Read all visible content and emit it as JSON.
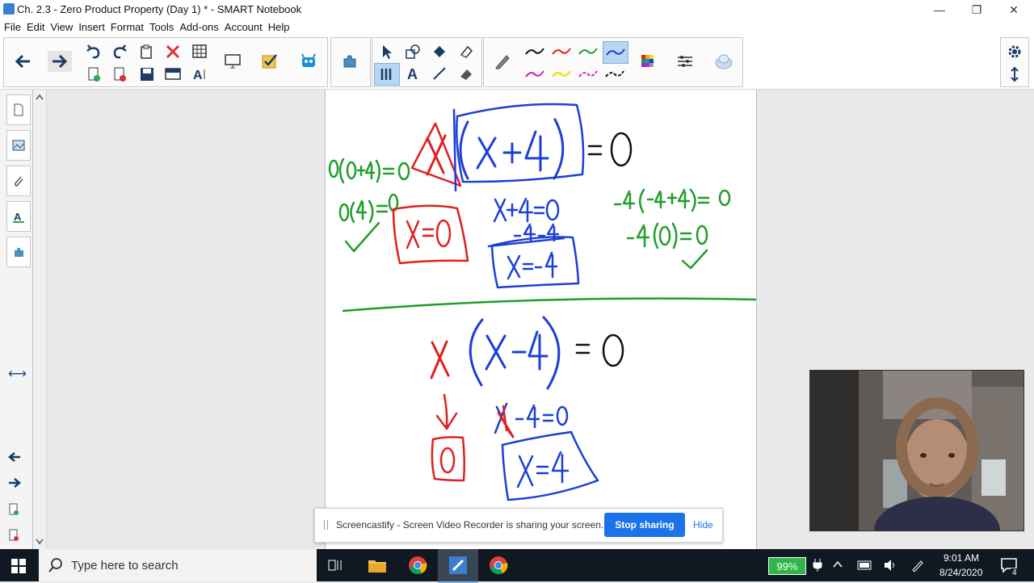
{
  "window": {
    "title": "Ch. 2.3 - Zero Product Property (Day 1) * - SMART Notebook",
    "minimize": "—",
    "restore": "❐",
    "close": "✕"
  },
  "menu": [
    "File",
    "Edit",
    "View",
    "Insert",
    "Format",
    "Tools",
    "Add-ons",
    "Account",
    "Help"
  ],
  "colors": {
    "accent": "#1a73e8",
    "ink_green": "#1f9e2a",
    "ink_red": "#e02020",
    "ink_blue": "#1c3fd6",
    "ink_black": "#111111",
    "taskbar": "#101822"
  },
  "toolbar": {
    "icons": [
      "back-icon",
      "forward-icon",
      "undo-icon",
      "redo-icon",
      "paste-icon",
      "delete-icon",
      "table-icon",
      "add-page-icon",
      "delete-page-icon",
      "save-icon",
      "screen-shade-icon",
      "text-format-icon",
      "display-icon",
      "response-icon",
      "monster-icon",
      "addon-icon",
      "select-icon",
      "shapes-icon",
      "fill-icon",
      "eraser-icon",
      "pen-icon",
      "magic-pen-icon",
      "text-icon",
      "line-icon",
      "eraser2-icon",
      "color-grid-icon",
      "properties-icon",
      "cloud-icon",
      "settings-icon",
      "move-toolbar-icon"
    ]
  },
  "sidebar": {
    "tabs": [
      "page-sorter-icon",
      "gallery-icon",
      "attachments-icon",
      "properties-icon",
      "addons-icon"
    ]
  },
  "canvas": {
    "top_problem": {
      "main_eq": "= 0",
      "left_check1": "0(0+4)=0",
      "left_check2": "0(4)=0",
      "solution1": "X=0",
      "step": "x+4=0",
      "step2": "-4 -4",
      "solution2": "X=-4",
      "right_check1": "-4(-4+4)=0",
      "right_check2": "-4(0)=0"
    },
    "bottom_problem": {
      "main_eq": "= 0",
      "solution1": "0",
      "step": "X-4=0",
      "solution2": "X=4"
    }
  },
  "share_bar": {
    "message": "Screencastify - Screen Video Recorder is sharing your screen.",
    "stop": "Stop sharing",
    "hide": "Hide"
  },
  "taskbar": {
    "search_placeholder": "Type here to search",
    "battery": "99%",
    "time": "9:01 AM",
    "date": "8/24/2020",
    "notifications": "4"
  }
}
